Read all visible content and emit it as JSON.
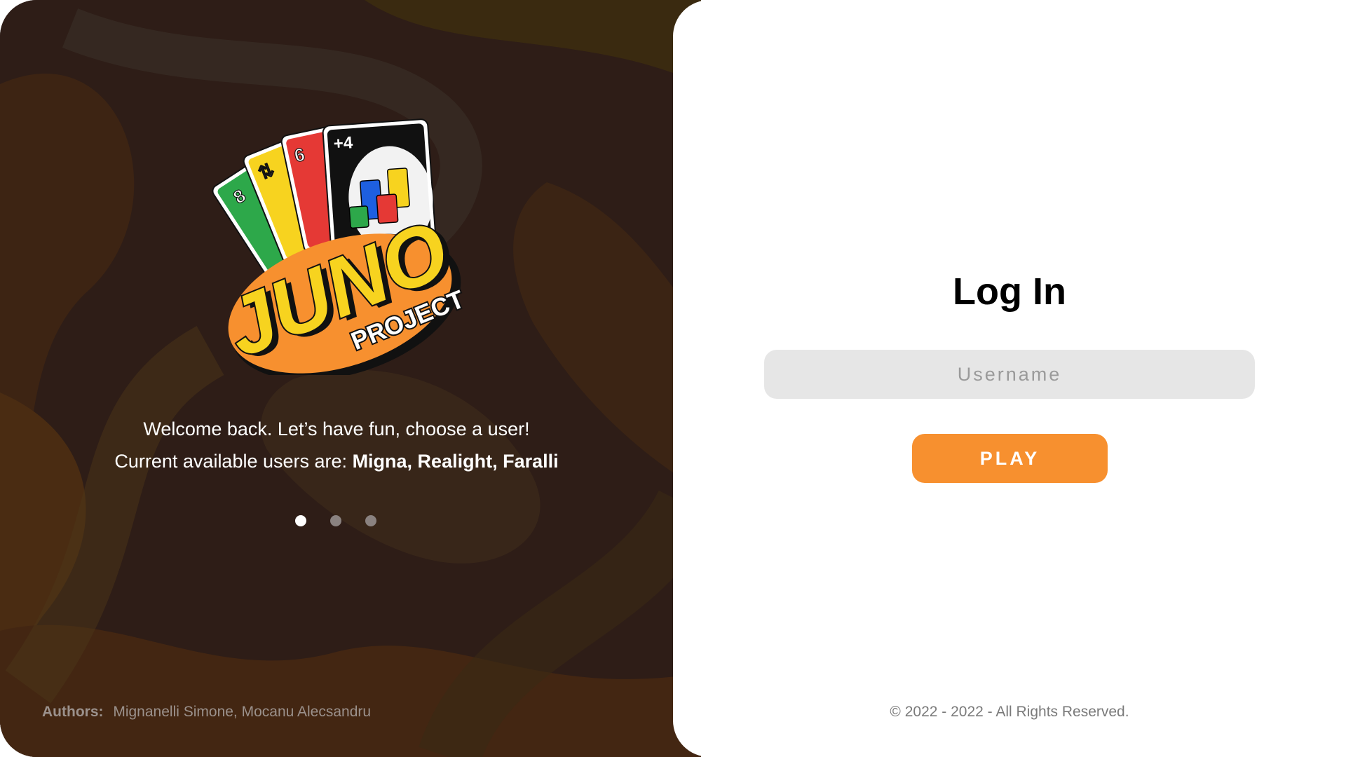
{
  "left": {
    "welcome_line": "Welcome back. Let’s have fun, choose a user!",
    "users_prefix": "Current available users are:",
    "users_list": "Migna, Realight, Faralli",
    "carousel_dots": 3,
    "active_dot": 0,
    "authors_label": "Authors:",
    "authors_names": "Mignanelli Simone, Mocanu Alecsandru"
  },
  "logo": {
    "title": "JUNO",
    "subtitle": "PROJECT",
    "cards": [
      "8",
      "⇅",
      "6",
      "+4"
    ]
  },
  "login": {
    "title": "Log In",
    "username_placeholder": "Username",
    "username_value": "",
    "play_label": "PLAY"
  },
  "footer": {
    "copyright": "© 2022 - 2022 - All Rights Reserved."
  },
  "colors": {
    "accent_orange": "#f7902f",
    "card_green": "#2da84a",
    "card_yellow": "#f7d31f",
    "card_red": "#e53935",
    "card_black": "#111111",
    "panel_dark": "#2e1d17"
  }
}
